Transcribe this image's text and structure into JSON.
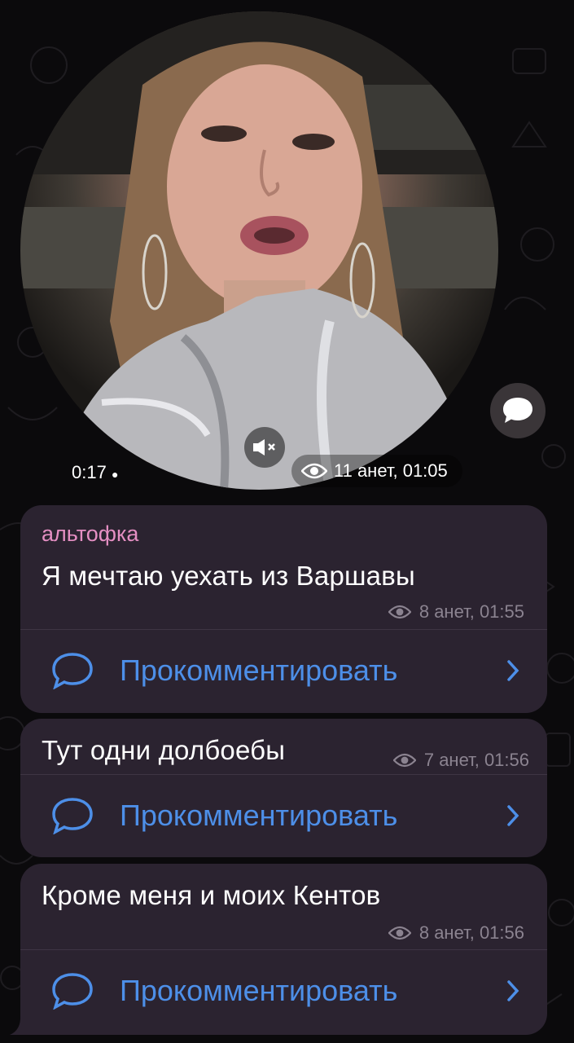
{
  "video": {
    "duration": "0:17",
    "date": "11 анет, 01:05",
    "icons": {
      "mute": "speaker-mute-icon",
      "views": "eye-icon",
      "fab": "comment-bubble-icon"
    }
  },
  "messages": [
    {
      "author": "альтофка",
      "text": "Я мечтаю уехать из Варшавы",
      "meta": "8 анет, 01:55",
      "comment_label": "Прокомментировать"
    },
    {
      "text": "Тут одни долбоебы",
      "meta": "7 анет, 01:56",
      "comment_label": "Прокомментировать"
    },
    {
      "text": "Кроме меня и моих Кентов",
      "meta": "8 анет, 01:56",
      "comment_label": "Прокомментировать"
    }
  ],
  "colors": {
    "bubble": "#2b2330",
    "author": "#e58fc3",
    "link": "#4d8fe8",
    "meta": "#8b8390"
  }
}
